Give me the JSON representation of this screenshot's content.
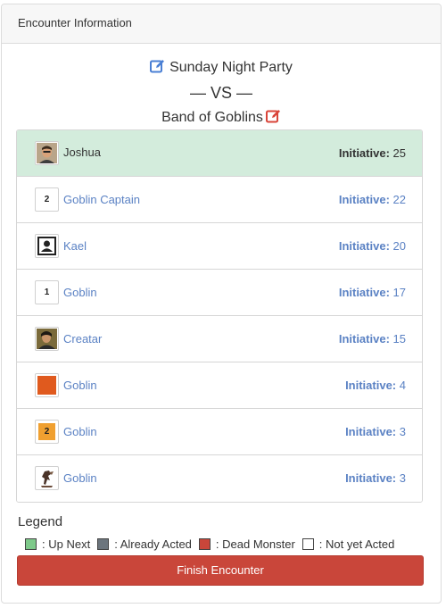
{
  "header": {
    "title": "Encounter Information"
  },
  "encounter": {
    "party": "Sunday Night Party",
    "vs": "— VS —",
    "monsters": "Band of Goblins"
  },
  "combatants": [
    {
      "name": "Joshua",
      "initiative_label": "Initiative:",
      "initiative": "25",
      "avatar": "portrait-joshua",
      "status": "up-next"
    },
    {
      "name": "Goblin Captain",
      "initiative_label": "Initiative:",
      "initiative": "22",
      "avatar_text": "2",
      "status": "not-yet-acted"
    },
    {
      "name": "Kael",
      "initiative_label": "Initiative:",
      "initiative": "20",
      "avatar": "person-silhouette-icon",
      "status": "not-yet-acted"
    },
    {
      "name": "Goblin",
      "initiative_label": "Initiative:",
      "initiative": "17",
      "avatar_text": "1",
      "status": "not-yet-acted"
    },
    {
      "name": "Creatar",
      "initiative_label": "Initiative:",
      "initiative": "15",
      "avatar": "portrait-creatar",
      "status": "not-yet-acted"
    },
    {
      "name": "Goblin",
      "initiative_label": "Initiative:",
      "initiative": "4",
      "avatar": "orange-square",
      "avatar_color": "#e05a1e",
      "status": "not-yet-acted"
    },
    {
      "name": "Goblin",
      "initiative_label": "Initiative:",
      "initiative": "3",
      "avatar_text": "2",
      "avatar_color": "#f0a030",
      "status": "not-yet-acted"
    },
    {
      "name": "Goblin",
      "initiative_label": "Initiative:",
      "initiative": "3",
      "avatar": "goblin-figure",
      "status": "not-yet-acted"
    }
  ],
  "legend": {
    "title": "Legend",
    "items": [
      {
        "label": ": Up Next",
        "color": "#7ec98a"
      },
      {
        "label": ": Already Acted",
        "color": "#6c757d"
      },
      {
        "label": ": Dead Monster",
        "color": "#c9463a"
      },
      {
        "label": ": Not yet Acted",
        "color": "#ffffff"
      }
    ]
  },
  "actions": {
    "finish_label": "Finish Encounter"
  },
  "colors": {
    "link": "#5b82c4",
    "active_row": "#d3ecdc",
    "danger": "#c9463a",
    "edit_blue": "#4a7fd4",
    "edit_red": "#d9453a"
  }
}
